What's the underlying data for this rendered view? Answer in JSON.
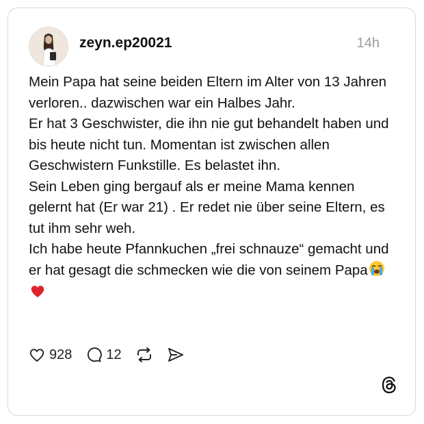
{
  "post": {
    "username": "zeyn.ep20021",
    "time": "14h",
    "lines": [
      "Mein Papa hat seine beiden Eltern im Alter von 13 Jahren verloren.. dazwischen war ein Halbes Jahr.",
      "Er hat 3 Geschwister, die ihn nie gut behandelt haben und bis heute nicht tun. Momentan ist zwischen allen Geschwistern Funkstille. Es belastet ihn.",
      "Sein Leben ging bergauf als er meine Mama kennen gelernt hat (Er war 21) . Er redet nie über seine Eltern, es tut ihm sehr weh.",
      "Ich habe heute Pfannkuchen „frei schnauze“ gemacht und er hat gesagt die schmecken wie die von seinem Papa"
    ],
    "emojis": [
      "crying-face",
      "red-heart"
    ]
  },
  "actions": {
    "likes": "928",
    "replies": "12",
    "icons": [
      "heart-icon",
      "comment-icon",
      "repost-icon",
      "share-icon"
    ]
  },
  "colors": {
    "text": "#111111",
    "muted": "#9a9a9a",
    "border": "#d9d9d9",
    "heart": "#e0242b",
    "emoji_face": "#f9c930",
    "emoji_tear": "#4aa3e8"
  }
}
